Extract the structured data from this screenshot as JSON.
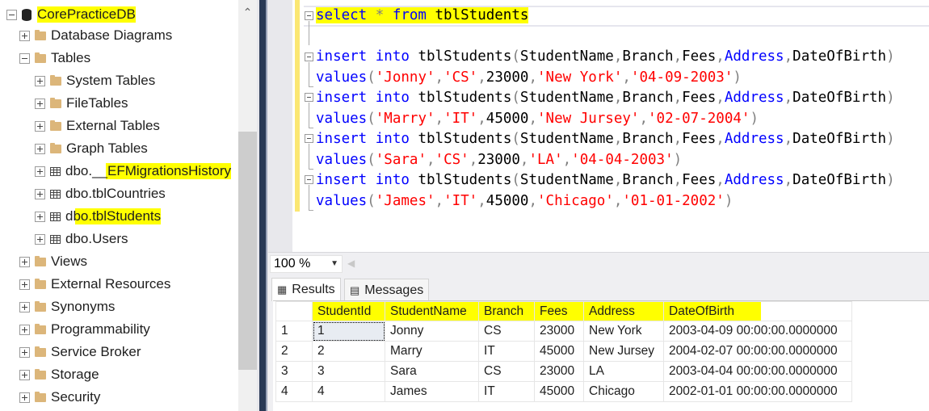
{
  "explorer": {
    "items": [
      {
        "label": "CorePracticeDB",
        "icon": "database-icon",
        "expander": "collapse",
        "highlight": true
      },
      {
        "label": "Database Diagrams",
        "icon": "folder-icon",
        "expander": "expand"
      },
      {
        "label": "Tables",
        "icon": "folder-icon",
        "expander": "collapse"
      },
      {
        "label": "System Tables",
        "icon": "folder-icon",
        "expander": "expand"
      },
      {
        "label": "FileTables",
        "icon": "folder-icon",
        "expander": "expand"
      },
      {
        "label": "External Tables",
        "icon": "folder-icon",
        "expander": "expand"
      },
      {
        "label": "Graph Tables",
        "icon": "folder-icon",
        "expander": "expand"
      },
      {
        "label": "dbo.__EFMigrationsHistory",
        "icon": "table-icon",
        "expander": "expand"
      },
      {
        "label": "dbo.tblCountries",
        "icon": "table-icon",
        "expander": "expand"
      },
      {
        "label": "dbo.tblStudents",
        "icon": "table-icon",
        "expander": "expand"
      },
      {
        "label": "dbo.Users",
        "icon": "table-icon",
        "expander": "expand"
      },
      {
        "label": "Views",
        "icon": "folder-icon",
        "expander": "expand"
      },
      {
        "label": "External Resources",
        "icon": "folder-icon",
        "expander": "expand"
      },
      {
        "label": "Synonyms",
        "icon": "folder-icon",
        "expander": "expand"
      },
      {
        "label": "Programmability",
        "icon": "folder-icon",
        "expander": "expand"
      },
      {
        "label": "Service Broker",
        "icon": "folder-icon",
        "expander": "expand"
      },
      {
        "label": "Storage",
        "icon": "folder-icon",
        "expander": "expand"
      },
      {
        "label": "Security",
        "icon": "folder-icon",
        "expander": "expand"
      }
    ]
  },
  "editor": {
    "select": {
      "kw1": "select",
      "star": " * ",
      "kw2": "from",
      "table": " tblStudents"
    },
    "insert_kw": "insert",
    "into_kw": "into",
    "insert_table": "tblStudents",
    "columns": {
      "c1": "StudentName",
      "c2": "Branch",
      "c3": "Fees",
      "c4": "Address",
      "c5": "DateOfBirth"
    },
    "values_kw": "values",
    "rows": [
      {
        "name": "'Jonny'",
        "branch": "'CS'",
        "fees": "23000",
        "address": "'New York'",
        "dob": "'04-09-2003'"
      },
      {
        "name": "'Marry'",
        "branch": "'IT'",
        "fees": "45000",
        "address": "'New Jursey'",
        "dob": "'02-07-2004'"
      },
      {
        "name": "'Sara'",
        "branch": "'CS'",
        "fees": "23000",
        "address": "'LA'",
        "dob": "'04-04-2003'"
      },
      {
        "name": "'James'",
        "branch": "'IT'",
        "fees": "45000",
        "address": "'Chicago'",
        "dob": "'01-01-2002'"
      }
    ]
  },
  "zoom": {
    "value": "100 %"
  },
  "results": {
    "tabs": [
      {
        "label": "Results"
      },
      {
        "label": "Messages"
      }
    ],
    "columns": [
      "StudentId",
      "StudentName",
      "Branch",
      "Fees",
      "Address",
      "DateOfBirth"
    ],
    "rows": [
      {
        "n": "1",
        "cells": [
          "1",
          "Jonny",
          "CS",
          "23000",
          "New York",
          "2003-04-09 00:00:00.0000000"
        ]
      },
      {
        "n": "2",
        "cells": [
          "2",
          "Marry",
          "IT",
          "45000",
          "New Jursey",
          "2004-02-07 00:00:00.0000000"
        ]
      },
      {
        "n": "3",
        "cells": [
          "3",
          "Sara",
          "CS",
          "23000",
          "LA",
          "2003-04-04 00:00:00.0000000"
        ]
      },
      {
        "n": "4",
        "cells": [
          "4",
          "James",
          "IT",
          "45000",
          "Chicago",
          "2002-01-01 00:00:00.0000000"
        ]
      }
    ]
  },
  "colors": {
    "highlight": "#ffff00",
    "keyword": "#0000ff",
    "string": "#ff0000",
    "splitter": "#293955"
  }
}
